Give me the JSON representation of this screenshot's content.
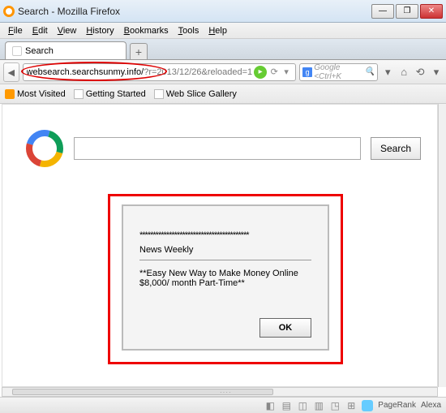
{
  "window": {
    "title": "Search - Mozilla Firefox",
    "controls": {
      "min": "—",
      "max": "❐",
      "close": "✕"
    }
  },
  "menu": [
    "File",
    "Edit",
    "View",
    "History",
    "Bookmarks",
    "Tools",
    "Help"
  ],
  "tab": {
    "label": "Search",
    "newtab": "+"
  },
  "nav": {
    "back": "◄",
    "url": "websearch.searchsunmy.info/?r=2013/12/26&reloaded=1",
    "url_display_prefix": "websearch.searchsunmy.info/",
    "url_display_suffix": "r=2013/12/26&reloaded=1",
    "go": "▸",
    "reload": "⟳",
    "stop": "▾",
    "search_engine": "g",
    "search_placeholder": "Google <Ctrl+K",
    "search_mag": "🔍",
    "dropdown": "▾",
    "home": "⌂",
    "sync": "⟲",
    "bookmark": "▾"
  },
  "bookmarks": {
    "most_visited": "Most Visited",
    "getting_started": "Getting Started",
    "web_slice": "Web Slice Gallery"
  },
  "page": {
    "search_button": "Search"
  },
  "popup": {
    "stars": "*****************************************",
    "source": "News Weekly",
    "line1": "**Easy New Way to Make Money Online",
    "line2": "$8,000/ month Part-Time**",
    "ok": "OK"
  },
  "status": {
    "pagerank": "PageRank",
    "alexa": "Alexa"
  }
}
